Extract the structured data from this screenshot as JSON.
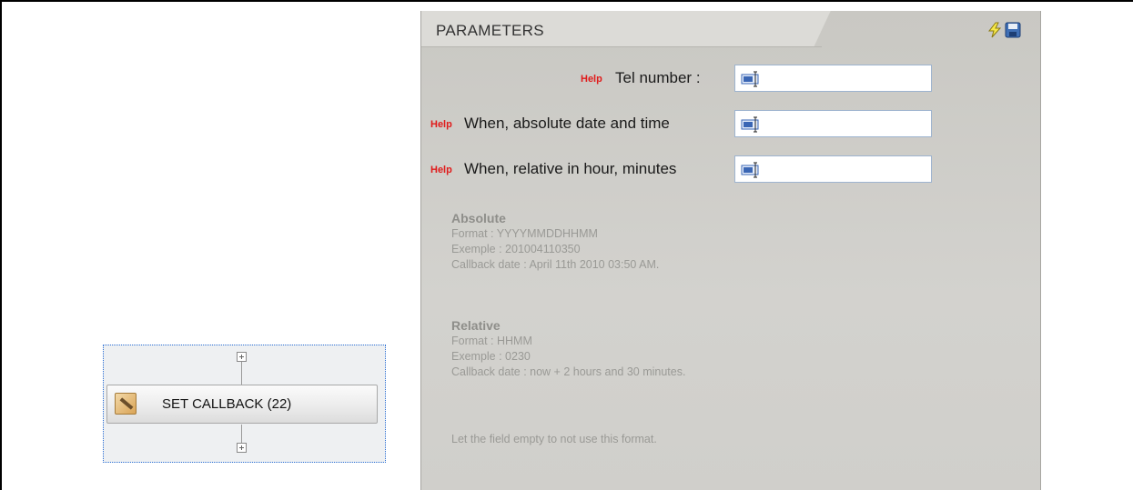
{
  "node": {
    "label": "SET CALLBACK (22)",
    "icon": "edit-note-icon"
  },
  "panel": {
    "title": "PARAMETERS",
    "help_label": "Help",
    "fields": [
      {
        "label": "Tel number :",
        "value": ""
      },
      {
        "label": "When, absolute date and time",
        "value": ""
      },
      {
        "label": "When, relative in hour, minutes",
        "value": ""
      }
    ],
    "absolute": {
      "heading": "Absolute",
      "format": "Format : YYYYMMDDHHMM",
      "example": "Exemple : 201004110350",
      "callback": "Callback date : April 11th 2010 03:50 AM."
    },
    "relative": {
      "heading": "Relative",
      "format": "Format : HHMM",
      "example": "Exemple : 0230",
      "callback": "Callback date : now + 2 hours and 30 minutes."
    },
    "note": "Let the field empty to not use this format."
  },
  "colors": {
    "help": "#e01b1b",
    "panel_bg": "#cfceca",
    "info_text": "#9a9a96"
  }
}
